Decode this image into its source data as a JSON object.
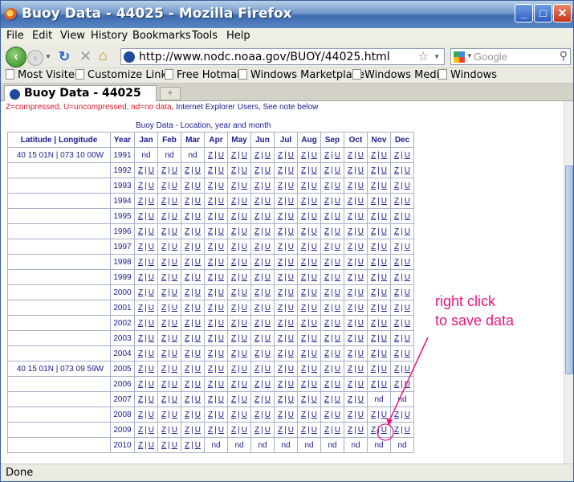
{
  "window": {
    "title": "Buoy Data - 44025 - Mozilla Firefox"
  },
  "menu": [
    "File",
    "Edit",
    "View",
    "History",
    "Bookmarks",
    "Tools",
    "Help"
  ],
  "nav": {
    "url": "http://www.nodc.noaa.gov/BUOY/44025.html",
    "search_placeholder": "Google"
  },
  "bookmarks": [
    "Most Visited",
    "Customize Links",
    "Free Hotmail",
    "Windows Marketplace",
    "Windows Media",
    "Windows"
  ],
  "tab": {
    "title": "Buoy Data - 44025",
    "new_tab": "+"
  },
  "legend": {
    "red": "Z=compressed, U=uncompressed, nd=no data,",
    "blue": "Internet Explorer Users, See note below"
  },
  "table": {
    "caption": "Buoy Data - Location, year and month",
    "header_location": "Latitude | Longitude",
    "header_year": "Year",
    "months": [
      "Jan",
      "Feb",
      "Mar",
      "Apr",
      "May",
      "Jun",
      "Jul",
      "Aug",
      "Sep",
      "Oct",
      "Nov",
      "Dec"
    ],
    "z": "Z",
    "u": "U",
    "sep": "|",
    "nd": "nd",
    "rows": [
      {
        "location": "40 15 01N | 073 10 00W",
        "year": "1991",
        "cells": [
          "nd",
          "nd",
          "nd",
          "Z|U",
          "Z|U",
          "Z|U",
          "Z|U",
          "Z|U",
          "Z|U",
          "Z|U",
          "Z|U",
          "Z|U"
        ]
      },
      {
        "location": "",
        "year": "1992",
        "cells": [
          "Z|U",
          "Z|U",
          "Z|U",
          "Z|U",
          "Z|U",
          "Z|U",
          "Z|U",
          "Z|U",
          "Z|U",
          "Z|U",
          "Z|U",
          "Z|U"
        ]
      },
      {
        "location": "",
        "year": "1993",
        "cells": [
          "Z|U",
          "Z|U",
          "Z|U",
          "Z|U",
          "Z|U",
          "Z|U",
          "Z|U",
          "Z|U",
          "Z|U",
          "Z|U",
          "Z|U",
          "Z|U"
        ]
      },
      {
        "location": "",
        "year": "1994",
        "cells": [
          "Z|U",
          "Z|U",
          "Z|U",
          "Z|U",
          "Z|U",
          "Z|U",
          "Z|U",
          "Z|U",
          "Z|U",
          "Z|U",
          "Z|U",
          "Z|U"
        ]
      },
      {
        "location": "",
        "year": "1995",
        "cells": [
          "Z|U",
          "Z|U",
          "Z|U",
          "Z|U",
          "Z|U",
          "Z|U",
          "Z|U",
          "Z|U",
          "Z|U",
          "Z|U",
          "Z|U",
          "Z|U"
        ]
      },
      {
        "location": "",
        "year": "1996",
        "cells": [
          "Z|U",
          "Z|U",
          "Z|U",
          "Z|U",
          "Z|U",
          "Z|U",
          "Z|U",
          "Z|U",
          "Z|U",
          "Z|U",
          "Z|U",
          "Z|U"
        ]
      },
      {
        "location": "",
        "year": "1997",
        "cells": [
          "Z|U",
          "Z|U",
          "Z|U",
          "Z|U",
          "Z|U",
          "Z|U",
          "Z|U",
          "Z|U",
          "Z|U",
          "Z|U",
          "Z|U",
          "Z|U"
        ]
      },
      {
        "location": "",
        "year": "1998",
        "cells": [
          "Z|U",
          "Z|U",
          "Z|U",
          "Z|U",
          "Z|U",
          "Z|U",
          "Z|U",
          "Z|U",
          "Z|U",
          "Z|U",
          "Z|U",
          "Z|U"
        ]
      },
      {
        "location": "",
        "year": "1999",
        "cells": [
          "Z|U",
          "Z|U",
          "Z|U",
          "Z|U",
          "Z|U",
          "Z|U",
          "Z|U",
          "Z|U",
          "Z|U",
          "Z|U",
          "Z|U",
          "Z|U"
        ]
      },
      {
        "location": "",
        "year": "2000",
        "cells": [
          "Z|U",
          "Z|U",
          "Z|U",
          "Z|U",
          "Z|U",
          "Z|U",
          "Z|U",
          "Z|U",
          "Z|U",
          "Z|U",
          "Z|U",
          "Z|U"
        ]
      },
      {
        "location": "",
        "year": "2001",
        "cells": [
          "Z|U",
          "Z|U",
          "Z|U",
          "Z|U",
          "Z|U",
          "Z|U",
          "Z|U",
          "Z|U",
          "Z|U",
          "Z|U",
          "Z|U",
          "Z|U"
        ]
      },
      {
        "location": "",
        "year": "2002",
        "cells": [
          "Z|U",
          "Z|U",
          "Z|U",
          "Z|U",
          "Z|U",
          "Z|U",
          "Z|U",
          "Z|U",
          "Z|U",
          "Z|U",
          "Z|U",
          "Z|U"
        ]
      },
      {
        "location": "",
        "year": "2003",
        "cells": [
          "Z|U",
          "Z|U",
          "Z|U",
          "Z|U",
          "Z|U",
          "Z|U",
          "Z|U",
          "Z|U",
          "Z|U",
          "Z|U",
          "Z|U",
          "Z|U"
        ]
      },
      {
        "location": "",
        "year": "2004",
        "cells": [
          "Z|U",
          "Z|U",
          "Z|U",
          "Z|U",
          "Z|U",
          "Z|U",
          "Z|U",
          "Z|U",
          "Z|U",
          "Z|U",
          "Z|U",
          "Z|U"
        ]
      },
      {
        "location": "40 15 01N | 073 09 59W",
        "year": "2005",
        "cells": [
          "Z|U",
          "Z|U",
          "Z|U",
          "Z|U",
          "Z|U",
          "Z|U",
          "Z|U",
          "Z|U",
          "Z|U",
          "Z|U",
          "Z|U",
          "Z|U"
        ]
      },
      {
        "location": "",
        "year": "2006",
        "cells": [
          "Z|U",
          "Z|U",
          "Z|U",
          "Z|U",
          "Z|U",
          "Z|U",
          "Z|U",
          "Z|U",
          "Z|U",
          "Z|U",
          "Z|U",
          "Z|U"
        ]
      },
      {
        "location": "",
        "year": "2007",
        "cells": [
          "Z|U",
          "Z|U",
          "Z|U",
          "Z|U",
          "Z|U",
          "Z|U",
          "Z|U",
          "Z|U",
          "Z|U",
          "Z|U",
          "nd",
          "nd"
        ]
      },
      {
        "location": "",
        "year": "2008",
        "cells": [
          "Z|U",
          "Z|U",
          "Z|U",
          "Z|U",
          "Z|U",
          "Z|U",
          "Z|U",
          "Z|U",
          "Z|U",
          "Z|U",
          "Z|U",
          "Z|U"
        ]
      },
      {
        "location": "",
        "year": "2009",
        "cells": [
          "Z|U",
          "Z|U",
          "Z|U",
          "Z|U",
          "Z|U",
          "Z|U",
          "Z|U",
          "Z|U",
          "Z|U",
          "Z|U",
          "Z|U",
          "Z|U"
        ]
      },
      {
        "location": "",
        "year": "2010",
        "cells": [
          "Z|U",
          "Z|U",
          "Z|U",
          "nd",
          "nd",
          "nd",
          "nd",
          "nd",
          "nd",
          "nd",
          "nd",
          "nd"
        ]
      }
    ]
  },
  "annotation": {
    "line1": "right click",
    "line2": "to save data",
    "color": "#e8177d"
  },
  "status": "Done"
}
